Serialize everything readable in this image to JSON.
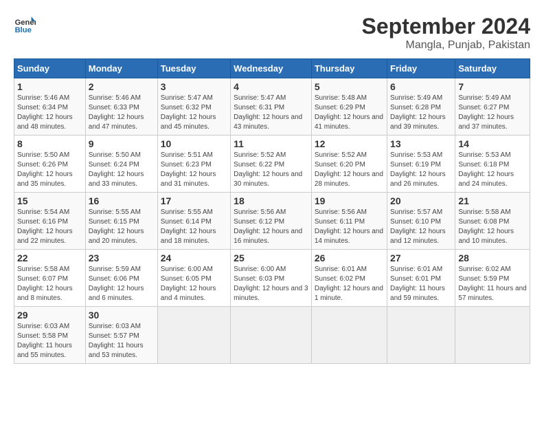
{
  "header": {
    "logo_line1": "General",
    "logo_line2": "Blue",
    "title": "September 2024",
    "subtitle": "Mangla, Punjab, Pakistan"
  },
  "weekdays": [
    "Sunday",
    "Monday",
    "Tuesday",
    "Wednesday",
    "Thursday",
    "Friday",
    "Saturday"
  ],
  "weeks": [
    [
      {
        "day": "1",
        "sunrise": "5:46 AM",
        "sunset": "6:34 PM",
        "daylight": "12 hours and 48 minutes."
      },
      {
        "day": "2",
        "sunrise": "5:46 AM",
        "sunset": "6:33 PM",
        "daylight": "12 hours and 47 minutes."
      },
      {
        "day": "3",
        "sunrise": "5:47 AM",
        "sunset": "6:32 PM",
        "daylight": "12 hours and 45 minutes."
      },
      {
        "day": "4",
        "sunrise": "5:47 AM",
        "sunset": "6:31 PM",
        "daylight": "12 hours and 43 minutes."
      },
      {
        "day": "5",
        "sunrise": "5:48 AM",
        "sunset": "6:29 PM",
        "daylight": "12 hours and 41 minutes."
      },
      {
        "day": "6",
        "sunrise": "5:49 AM",
        "sunset": "6:28 PM",
        "daylight": "12 hours and 39 minutes."
      },
      {
        "day": "7",
        "sunrise": "5:49 AM",
        "sunset": "6:27 PM",
        "daylight": "12 hours and 37 minutes."
      }
    ],
    [
      {
        "day": "8",
        "sunrise": "5:50 AM",
        "sunset": "6:26 PM",
        "daylight": "12 hours and 35 minutes."
      },
      {
        "day": "9",
        "sunrise": "5:50 AM",
        "sunset": "6:24 PM",
        "daylight": "12 hours and 33 minutes."
      },
      {
        "day": "10",
        "sunrise": "5:51 AM",
        "sunset": "6:23 PM",
        "daylight": "12 hours and 31 minutes."
      },
      {
        "day": "11",
        "sunrise": "5:52 AM",
        "sunset": "6:22 PM",
        "daylight": "12 hours and 30 minutes."
      },
      {
        "day": "12",
        "sunrise": "5:52 AM",
        "sunset": "6:20 PM",
        "daylight": "12 hours and 28 minutes."
      },
      {
        "day": "13",
        "sunrise": "5:53 AM",
        "sunset": "6:19 PM",
        "daylight": "12 hours and 26 minutes."
      },
      {
        "day": "14",
        "sunrise": "5:53 AM",
        "sunset": "6:18 PM",
        "daylight": "12 hours and 24 minutes."
      }
    ],
    [
      {
        "day": "15",
        "sunrise": "5:54 AM",
        "sunset": "6:16 PM",
        "daylight": "12 hours and 22 minutes."
      },
      {
        "day": "16",
        "sunrise": "5:55 AM",
        "sunset": "6:15 PM",
        "daylight": "12 hours and 20 minutes."
      },
      {
        "day": "17",
        "sunrise": "5:55 AM",
        "sunset": "6:14 PM",
        "daylight": "12 hours and 18 minutes."
      },
      {
        "day": "18",
        "sunrise": "5:56 AM",
        "sunset": "6:12 PM",
        "daylight": "12 hours and 16 minutes."
      },
      {
        "day": "19",
        "sunrise": "5:56 AM",
        "sunset": "6:11 PM",
        "daylight": "12 hours and 14 minutes."
      },
      {
        "day": "20",
        "sunrise": "5:57 AM",
        "sunset": "6:10 PM",
        "daylight": "12 hours and 12 minutes."
      },
      {
        "day": "21",
        "sunrise": "5:58 AM",
        "sunset": "6:08 PM",
        "daylight": "12 hours and 10 minutes."
      }
    ],
    [
      {
        "day": "22",
        "sunrise": "5:58 AM",
        "sunset": "6:07 PM",
        "daylight": "12 hours and 8 minutes."
      },
      {
        "day": "23",
        "sunrise": "5:59 AM",
        "sunset": "6:06 PM",
        "daylight": "12 hours and 6 minutes."
      },
      {
        "day": "24",
        "sunrise": "6:00 AM",
        "sunset": "6:05 PM",
        "daylight": "12 hours and 4 minutes."
      },
      {
        "day": "25",
        "sunrise": "6:00 AM",
        "sunset": "6:03 PM",
        "daylight": "12 hours and 3 minutes."
      },
      {
        "day": "26",
        "sunrise": "6:01 AM",
        "sunset": "6:02 PM",
        "daylight": "12 hours and 1 minute."
      },
      {
        "day": "27",
        "sunrise": "6:01 AM",
        "sunset": "6:01 PM",
        "daylight": "11 hours and 59 minutes."
      },
      {
        "day": "28",
        "sunrise": "6:02 AM",
        "sunset": "5:59 PM",
        "daylight": "11 hours and 57 minutes."
      }
    ],
    [
      {
        "day": "29",
        "sunrise": "6:03 AM",
        "sunset": "5:58 PM",
        "daylight": "11 hours and 55 minutes."
      },
      {
        "day": "30",
        "sunrise": "6:03 AM",
        "sunset": "5:57 PM",
        "daylight": "11 hours and 53 minutes."
      },
      null,
      null,
      null,
      null,
      null
    ]
  ]
}
